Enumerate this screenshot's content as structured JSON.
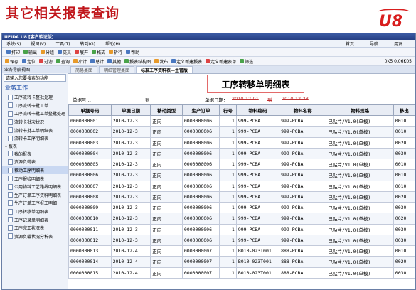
{
  "slide": {
    "title": "其它相关报表查询",
    "logo": "U8"
  },
  "window": {
    "title": "UFIDA U8 [客户验证版]"
  },
  "menu": {
    "items": [
      "系统(S)",
      "视图(V)",
      "工具(T)",
      "转到(G)",
      "帮助(H)"
    ],
    "right": [
      "首页",
      "导航",
      "用友"
    ]
  },
  "toolbar1": [
    "打印",
    "输出",
    "分组",
    "交叉",
    "展开",
    "格式",
    "折行",
    "帮助"
  ],
  "toolbar2": [
    "保存",
    "定位",
    "过滤",
    "查询",
    "小计",
    "总计",
    "其他",
    "报表结构图",
    "发布",
    "定义新建报表",
    "定义新建表单",
    "筛选"
  ],
  "toolbar_extra": {
    "price": "0K5 0.06K05"
  },
  "sidebar": {
    "header": "业务导航视图",
    "search_placeholder": "请输入您要搜索的功能",
    "section": "业务工作",
    "items": [
      {
        "label": "工序流转卡整批处理",
        "type": "item"
      },
      {
        "label": "工序流转卡批工单",
        "type": "item"
      },
      {
        "label": "工序流转卡批工单整批处理",
        "type": "item"
      },
      {
        "label": "流转卡批次状况",
        "type": "item"
      },
      {
        "label": "流转卡批工单明细表",
        "type": "item"
      },
      {
        "label": "流转卡工序明细表",
        "type": "item"
      },
      {
        "label": "报表",
        "type": "group"
      },
      {
        "label": "我的报表",
        "type": "item"
      },
      {
        "label": "资源负荷表",
        "type": "item"
      },
      {
        "label": "移动工序明细表",
        "type": "active"
      },
      {
        "label": "工序报检明细表",
        "type": "item"
      },
      {
        "label": "公用物料工艺路线明细表",
        "type": "item"
      },
      {
        "label": "生产订单工序资料明细表",
        "type": "item"
      },
      {
        "label": "生产订单工序报工明细",
        "type": "item"
      },
      {
        "label": "工序转移单明细表",
        "type": "item"
      },
      {
        "label": "工序记录单明细表",
        "type": "item"
      },
      {
        "label": "工序完工状况表",
        "type": "item"
      },
      {
        "label": "资源负载状况分析表",
        "type": "item"
      }
    ]
  },
  "tabs": [
    "简易桌面",
    "明细管理桌面",
    "标准工序资料表—生管版"
  ],
  "report": {
    "title": "工序转移单明细表",
    "filter_no_label": "单据号…",
    "filter_to": "到",
    "filter_date": "单据日期：",
    "date_from": "2010-12-01",
    "date_to_label": "到",
    "date_to": "2010-12-28"
  },
  "table": {
    "columns": [
      "单据号码",
      "单据日期",
      "移动类型",
      "生产订单",
      "行号",
      "物料编码",
      "物料名称",
      "物料规格",
      "移出"
    ],
    "rows": [
      [
        "0000000001",
        "2010-12-3",
        "正向",
        "0000000006",
        "1",
        "999-PCBA",
        "999-PCBA",
        "已贴片/V1.0(单模)",
        "0010"
      ],
      [
        "0000000002",
        "2010-12-3",
        "正向",
        "0000000006",
        "1",
        "999-PCBA",
        "999-PCBA",
        "已贴片/V1.0(单模)",
        "0010"
      ],
      [
        "0000000003",
        "2010-12-3",
        "正向",
        "0000000006",
        "1",
        "999-PCBA",
        "999-PCBA",
        "已贴片/V1.0(单模)",
        "0020"
      ],
      [
        "0000000004",
        "2010-12-3",
        "正向",
        "0000000006",
        "1",
        "999-PCBA",
        "999-PCBA",
        "已贴片/V1.0(单模)",
        "0030"
      ],
      [
        "0000000005",
        "2010-12-3",
        "正向",
        "0000000006",
        "1",
        "999-PCBA",
        "999-PCBA",
        "已贴片/V1.0(单模)",
        "0010"
      ],
      [
        "0000000006",
        "2010-12-3",
        "正向",
        "0000000006",
        "1",
        "999-PCBA",
        "999-PCBA",
        "已贴片/V1.0(单模)",
        "0010"
      ],
      [
        "0000000007",
        "2010-12-3",
        "正向",
        "0000000006",
        "1",
        "999-PCBA",
        "999-PCBA",
        "已贴片/V1.0(单模)",
        "0010"
      ],
      [
        "0000000008",
        "2010-12-3",
        "正向",
        "0000000006",
        "1",
        "999-PCBA",
        "999-PCBA",
        "已贴片/V1.0(单模)",
        "0020"
      ],
      [
        "0000000009",
        "2010-12-3",
        "正向",
        "0000000006",
        "1",
        "999-PCBA",
        "999-PCBA",
        "已贴片/V1.0(单模)",
        "0030"
      ],
      [
        "0000000010",
        "2010-12-3",
        "正向",
        "0000000006",
        "1",
        "999-PCBA",
        "999-PCBA",
        "已贴片/V1.0(单模)",
        "0020"
      ],
      [
        "0000000011",
        "2010-12-3",
        "正向",
        "0000000006",
        "1",
        "999-PCBA",
        "999-PCBA",
        "已贴片/V1.0(单模)",
        "0030"
      ],
      [
        "0000000012",
        "2010-12-3",
        "正向",
        "0000000006",
        "1",
        "999-PCBA",
        "999-PCBA",
        "已贴片/V1.0(单模)",
        "0030"
      ],
      [
        "0000000013",
        "2010-12-4",
        "正向",
        "0000000007",
        "1",
        "B010-023T001",
        "888-PCBA",
        "已贴片/V1.0(单模)",
        "0010"
      ],
      [
        "0000000014",
        "2010-12-4",
        "正向",
        "0000000007",
        "1",
        "B010-023T001",
        "888-PCBA",
        "已贴片/V1.0(单模)",
        "0020"
      ],
      [
        "0000000015",
        "2010-12-4",
        "正向",
        "0000000007",
        "1",
        "B010-023T001",
        "888-PCBA",
        "已贴片/V1.0(单模)",
        "0030"
      ]
    ]
  },
  "colors": {
    "slide_title": "#c0161b",
    "window_title": "#263f84",
    "accent": "#3a64b3"
  }
}
